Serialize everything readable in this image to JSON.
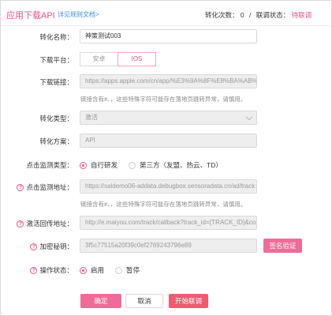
{
  "header": {
    "title": "应用下载API",
    "doc_link": "详见规则文档>",
    "conversions_label": "转化次数：",
    "conversions_value": "0",
    "separator": "/",
    "status_label": "联调状态：",
    "status_value": "待联调"
  },
  "form": {
    "name": {
      "label": "转化名称：",
      "value": "神策测试003"
    },
    "platform": {
      "label": "下载平台：",
      "options": [
        "安卓",
        "IOS"
      ],
      "selected": "IOS"
    },
    "download_link": {
      "label": "下载链接：",
      "value": "https://apps.apple.com/cn/app/%E3%9A%8F%E8%BA%AB%",
      "hint": "链接含有#、，这些特殊字符可能存在落地页跳转异常，请慎用。"
    },
    "conversion_type": {
      "label": "转化类型：",
      "value": "激活"
    },
    "conversion_scheme": {
      "label": "转化方案：",
      "value": "API"
    },
    "click_monitor_type": {
      "label": "点击监测类型：",
      "options": [
        "自行研发",
        "第三方（友盟、热云、TD）"
      ],
      "selected": "自行研发"
    },
    "click_monitor_url": {
      "label": "点击监测地址：",
      "value": "https://saldemo06-addata.debugbox.sensoradata.cn/ad/track",
      "hint": "链接含有#、，这些特殊字符可能存在落地页跳转异常，请慎用。"
    },
    "callback_url": {
      "label": "激活回传地址：",
      "value": "http://e.maiyou.com/track/callback?track_id={TRACK_ID}&co"
    },
    "secret_key": {
      "label": "加密秘钥：",
      "value": "3f5c77515a20f39c0ef2769243796e89",
      "sign_button": "签名验证"
    },
    "operate_status": {
      "label": "操作状态：",
      "options": [
        "启用",
        "暂停"
      ],
      "selected": "启用"
    }
  },
  "footer": {
    "confirm": "确定",
    "cancel": "取消",
    "start_debug": "开始联调"
  },
  "colors": {
    "accent": "#e8508a",
    "link": "#3b8ed8",
    "danger": "#ef5c70"
  }
}
